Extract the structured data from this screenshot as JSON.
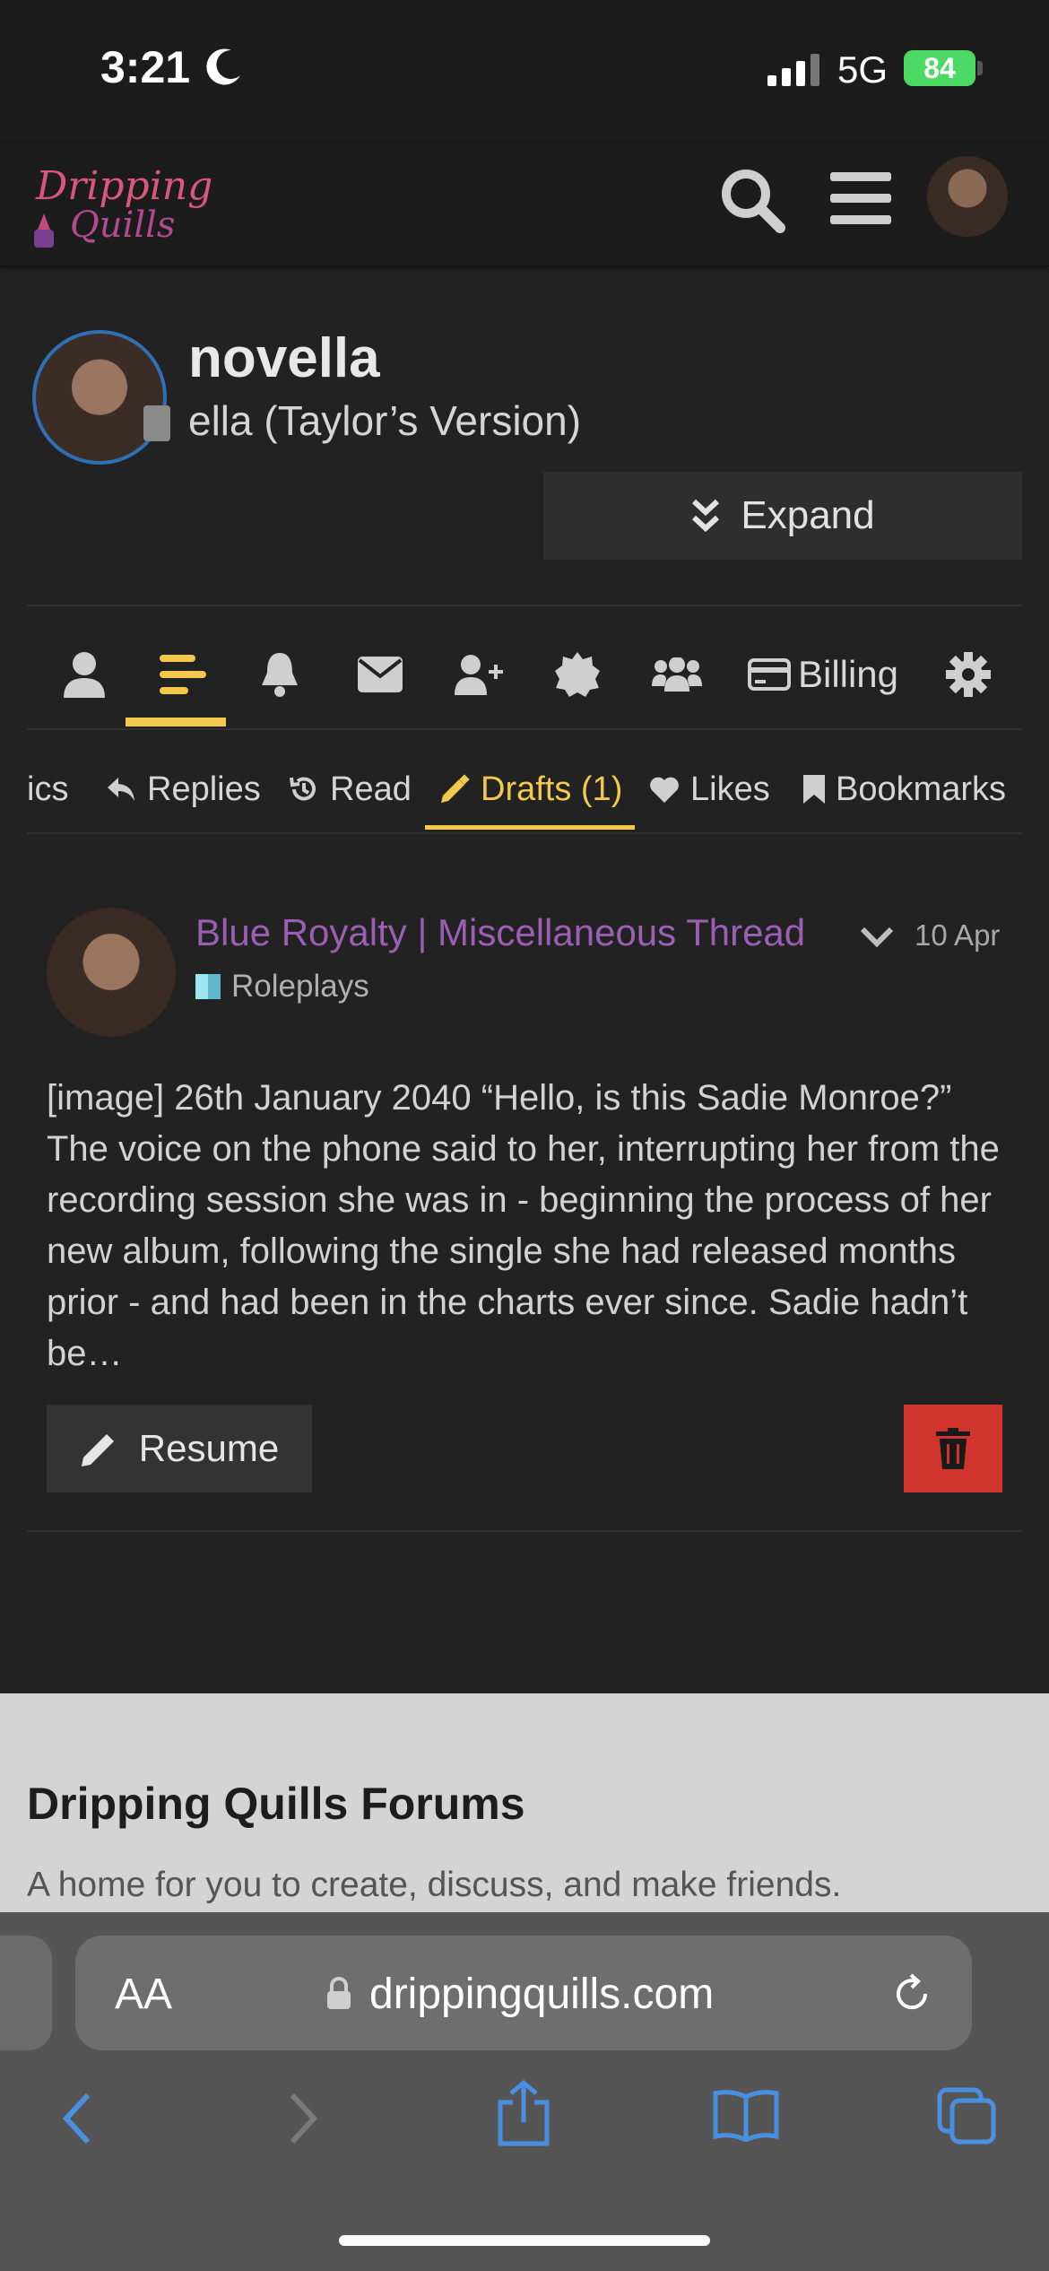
{
  "status_bar": {
    "time": "3:21",
    "network": "5G",
    "battery": "84"
  },
  "header": {
    "logo_line1": "Dripping",
    "logo_line2": "Quills"
  },
  "profile": {
    "username": "novella",
    "user_title": "ella (Taylor’s Version)",
    "expand_label": "Expand"
  },
  "nav": {
    "billing_label": "Billing",
    "items": [
      "user-icon",
      "activity-icon",
      "bell-icon",
      "envelope-icon",
      "user-plus-icon",
      "badge-icon",
      "users-icon",
      "card-icon",
      "gear-icon"
    ]
  },
  "subtabs": {
    "topics": "ics",
    "replies": "Replies",
    "read": "Read",
    "drafts": "Drafts (1)",
    "likes": "Likes",
    "bookmarks": "Bookmarks"
  },
  "draft": {
    "thread_title": "Blue Royalty | Miscellaneous Thread",
    "category": "Roleplays",
    "date": "10 Apr",
    "excerpt": "[image] 26th January 2040 “Hello, is this Sadie Monroe?” The voice on the phone said to her, interrupting her from the recording session she was in - beginning the process of her new album, following the single she had released months prior - and had been in the charts ever since. Sadie hadn’t be…",
    "resume_label": "Resume"
  },
  "footer": {
    "title": "Dripping Quills Forums",
    "description": "A home for you to create, discuss, and make friends."
  },
  "browser": {
    "text_size_label": "AA",
    "url": "drippingquills.com"
  },
  "colors": {
    "accent": "#f2c94c",
    "thread_title": "#9a5fb3",
    "delete": "#d0342c",
    "avatar_ring": "#2f6fb3"
  }
}
